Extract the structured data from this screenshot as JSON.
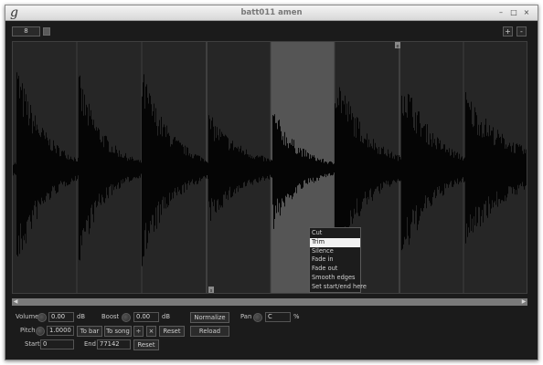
{
  "window": {
    "app_logo": "g",
    "title": "batt011 amen",
    "controls": {
      "minimize": "–",
      "maximize": "□",
      "close": "×"
    }
  },
  "toolbar": {
    "zoom_value": "8",
    "zoom_in_label": "+",
    "zoom_out_label": "-"
  },
  "waveform": {
    "range_start_marker": "s",
    "range_end_marker": "e",
    "colors": {
      "background": "#262626",
      "waveform": "#050505",
      "selection": "#555555",
      "gridline": "#3f3f3f"
    }
  },
  "context_menu": {
    "items": [
      {
        "label": "Cut"
      },
      {
        "label": "Trim",
        "selected": true
      },
      {
        "label": "Silence"
      },
      {
        "label": "Fade in"
      },
      {
        "label": "Fade out"
      },
      {
        "label": "Smooth edges"
      },
      {
        "label": "Set start/end here"
      }
    ]
  },
  "scrollbar": {
    "left_arrow": "◀",
    "right_arrow": "▶"
  },
  "controls": {
    "volume_label": "Volume",
    "volume_value": "0.00",
    "volume_unit": "dB",
    "boost_label": "Boost",
    "boost_value": "0.00",
    "boost_unit": "dB",
    "normalize_label": "Normalize",
    "pan_label": "Pan",
    "pan_value": "C",
    "pan_unit": "%",
    "pitch_label": "Pitch",
    "pitch_value": "1.0000",
    "to_bar_label": "To bar",
    "to_song_label": "To song",
    "pitch_double_label": "÷",
    "pitch_half_label": "×",
    "pitch_reset_label": "Reset",
    "reload_label": "Reload",
    "start_label": "Start",
    "start_value": "0",
    "end_label": "End",
    "end_value": "77142",
    "range_reset_label": "Reset"
  }
}
